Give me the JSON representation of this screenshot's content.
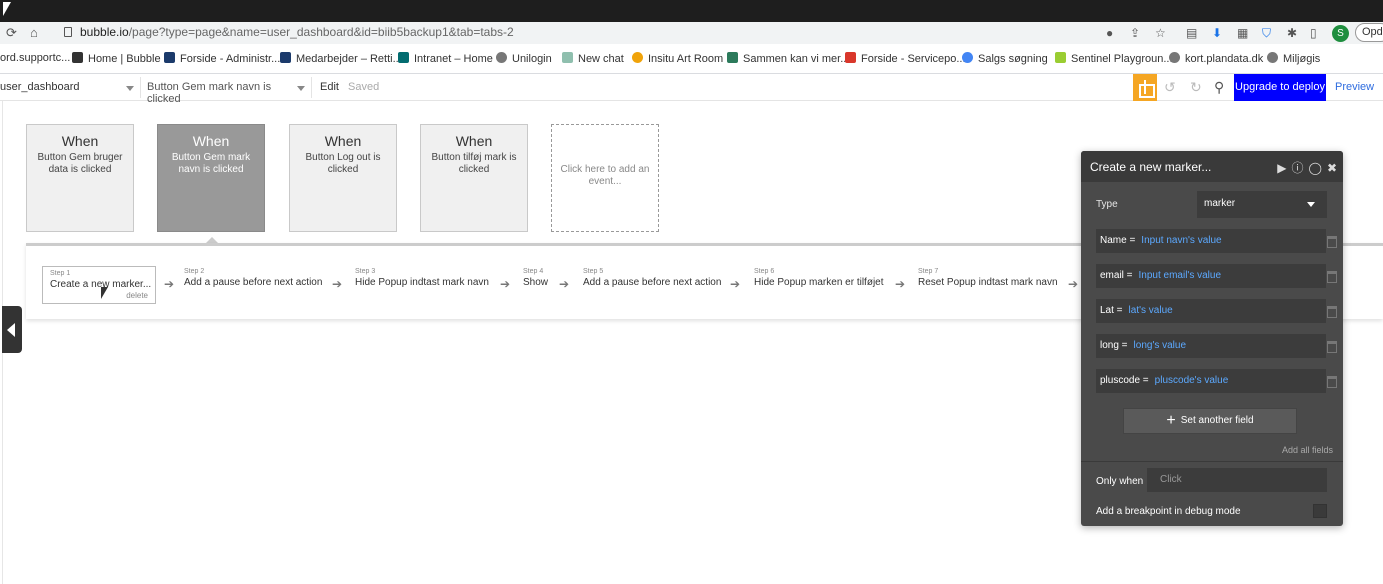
{
  "browser": {
    "url_host": "bubble.io",
    "url_path": "/page?type=page&name=user_dashboard&id=biib5backup1&tab=tabs-2",
    "update_label": "Opd"
  },
  "bookmarks": [
    "ord.supportc...",
    "Home | Bubble",
    "Forside - Administr...",
    "Medarbejder – Retti...",
    "Intranet – Home",
    "Unilogin",
    "New chat",
    "Insitu Art Room",
    "Sammen kan vi mer...",
    "Forside - Servicepo...",
    "Salgs søgning",
    "Sentinel Playgroun...",
    "kort.plandata.dk",
    "Miljøgis"
  ],
  "toolbar": {
    "page_name": "user_dashboard",
    "event_name": "Button Gem mark navn is clicked",
    "edit_label": "Edit",
    "saved_label": "Saved",
    "upgrade_label": "Upgrade to deploy",
    "preview_label": "Preview"
  },
  "events": [
    {
      "when": "When",
      "desc": "Button Gem bruger data is clicked"
    },
    {
      "when": "When",
      "desc": "Button Gem mark navn is clicked"
    },
    {
      "when": "When",
      "desc": "Button Log out is clicked"
    },
    {
      "when": "When",
      "desc": "Button tilføj mark is clicked"
    }
  ],
  "add_event_label": "Click here to add an event...",
  "steps": [
    {
      "num": "Step 1",
      "name": "Create a new marker...",
      "delete": "delete"
    },
    {
      "num": "Step 2",
      "name": "Add a pause before next action"
    },
    {
      "num": "Step 3",
      "name": "Hide Popup indtast mark navn"
    },
    {
      "num": "Step 4",
      "name": "Show"
    },
    {
      "num": "Step 5",
      "name": "Add a pause before next action"
    },
    {
      "num": "Step 6",
      "name": "Hide Popup marken er tilføjet"
    },
    {
      "num": "Step 7",
      "name": "Reset Popup indtast mark navn"
    }
  ],
  "editor": {
    "title": "Create a new marker...",
    "type_label": "Type",
    "type_value": "marker",
    "fields": [
      {
        "key": "Name =",
        "value": "Input navn's value"
      },
      {
        "key": "email =",
        "value": "Input email's value"
      },
      {
        "key": "Lat =",
        "value": "lat's value"
      },
      {
        "key": "long =",
        "value": "long's value"
      },
      {
        "key": "pluscode =",
        "value": "pluscode's value"
      }
    ],
    "set_another_field": "Set another field",
    "add_all_fields": "Add all fields",
    "only_when_label": "Only when",
    "only_when_placeholder": "Click",
    "breakpoint_label": "Add a breakpoint in debug mode"
  }
}
